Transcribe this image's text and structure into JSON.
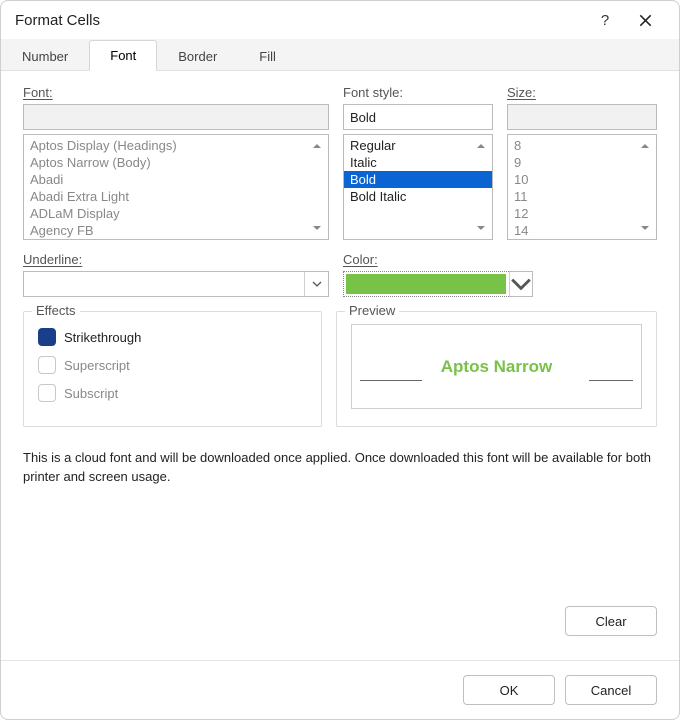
{
  "window": {
    "title": "Format Cells"
  },
  "tabs": {
    "items": [
      "Number",
      "Font",
      "Border",
      "Fill"
    ],
    "active_index": 1
  },
  "font_section": {
    "label": "Font:",
    "value": "",
    "options": [
      "Aptos Display (Headings)",
      "Aptos Narrow (Body)",
      "Abadi",
      "Abadi Extra Light",
      "ADLaM Display",
      "Agency FB"
    ]
  },
  "style_section": {
    "label": "Font style:",
    "value": "Bold",
    "options": [
      "Regular",
      "Italic",
      "Bold",
      "Bold Italic"
    ],
    "selected_index": 2
  },
  "size_section": {
    "label": "Size:",
    "value": "",
    "options": [
      "8",
      "9",
      "10",
      "11",
      "12",
      "14"
    ]
  },
  "underline": {
    "label": "Underline:",
    "value": ""
  },
  "color": {
    "label": "Color:",
    "value_hex": "#78c248"
  },
  "effects": {
    "legend": "Effects",
    "strikethrough": {
      "label": "Strikethrough",
      "checked": true
    },
    "superscript": {
      "label": "Superscript",
      "checked": false
    },
    "subscript": {
      "label": "Subscript",
      "checked": false
    }
  },
  "preview": {
    "legend": "Preview",
    "text": "Aptos Narrow"
  },
  "notice": "This is a cloud font and will be downloaded once applied. Once downloaded this font will be available for both printer and screen usage.",
  "buttons": {
    "clear": "Clear",
    "ok": "OK",
    "cancel": "Cancel"
  }
}
